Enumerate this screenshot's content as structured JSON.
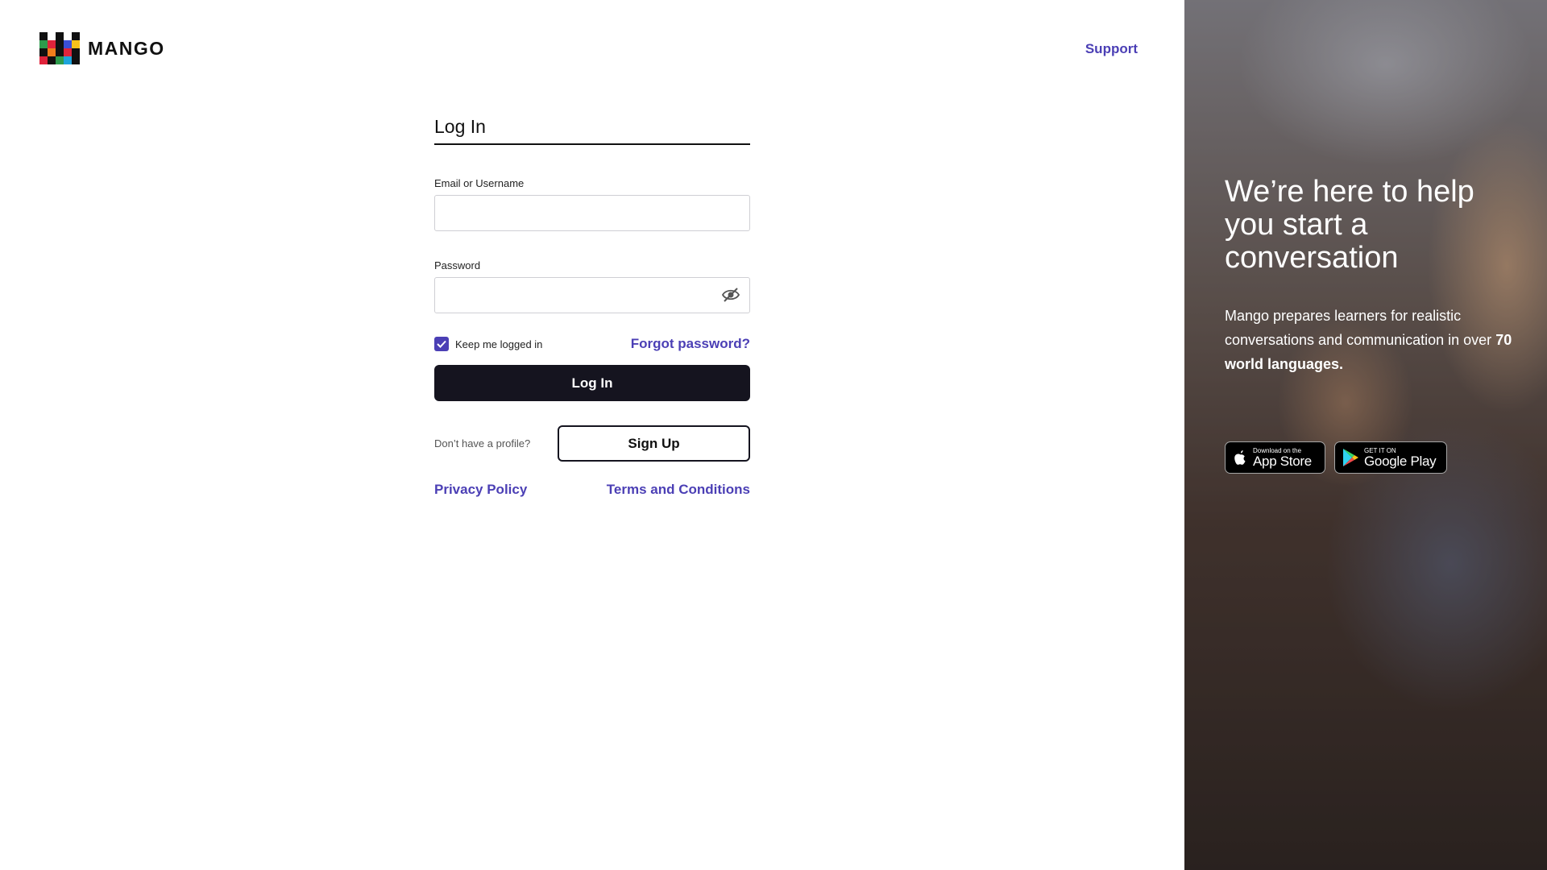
{
  "brand": {
    "name": "MANGO"
  },
  "header": {
    "support_label": "Support"
  },
  "login_form": {
    "title": "Log In",
    "email_label": "Email or Username",
    "email_value": "",
    "password_label": "Password",
    "password_value": "",
    "keep_logged_in_label": "Keep me logged in",
    "keep_logged_in_checked": true,
    "forgot_password_label": "Forgot password?",
    "submit_label": "Log In",
    "no_profile_text": "Don’t have a profile?",
    "signup_label": "Sign Up",
    "privacy_label": "Privacy Policy",
    "terms_label": "Terms and Conditions"
  },
  "hero": {
    "heading": "We’re here to help you start a conversation",
    "text_prefix": "Mango prepares learners for realistic conversations and communication in over",
    "text_bold": "70 world languages."
  },
  "app_badges": {
    "app_store": {
      "small": "Download on the",
      "big": "App Store"
    },
    "google_play": {
      "small": "GET IT ON",
      "big": "Google Play"
    }
  },
  "colors": {
    "accent": "#4b3fb5",
    "button_dark": "#15141f"
  },
  "icons": [
    "mango-logo-icon",
    "eye-hidden-icon",
    "checkmark-icon",
    "apple-icon",
    "google-play-icon"
  ]
}
